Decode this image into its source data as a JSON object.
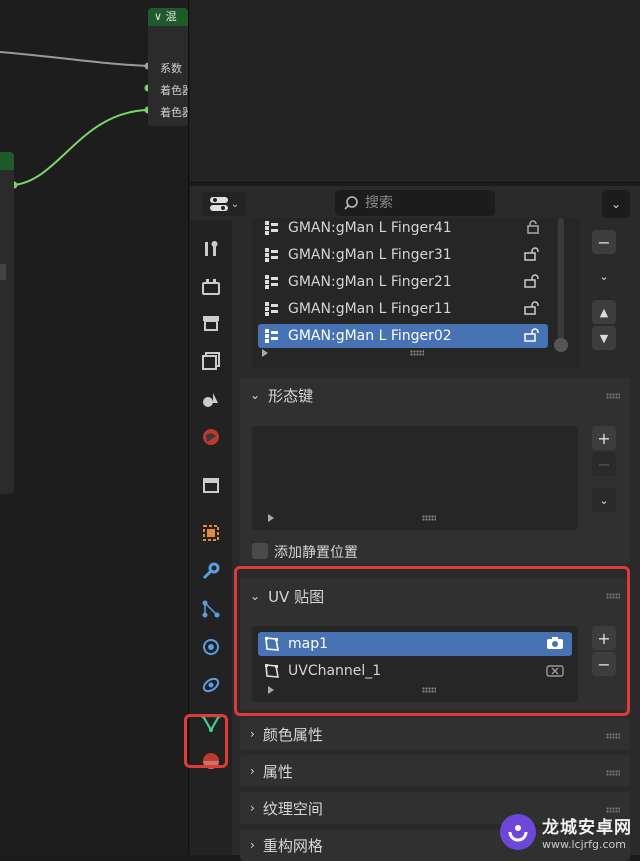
{
  "node_editor": {
    "mix_node": {
      "title": "混",
      "sockets": [
        "系数",
        "着色器",
        "着色器"
      ]
    }
  },
  "properties": {
    "search": {
      "placeholder": "搜索"
    },
    "tabs": [
      "tool-icon",
      "render-icon",
      "output-icon",
      "view-layer-icon",
      "scene-icon",
      "world-icon",
      "collection-icon",
      "object-icon",
      "modifier-icon",
      "particles-icon",
      "physics-icon",
      "constraints-icon",
      "data-icon",
      "material-icon"
    ],
    "bone_list": {
      "items": [
        {
          "label": "GMAN:gMan L Finger41",
          "selected": false
        },
        {
          "label": "GMAN:gMan L Finger31",
          "selected": false
        },
        {
          "label": "GMAN:gMan L Finger21",
          "selected": false
        },
        {
          "label": "GMAN:gMan L Finger11",
          "selected": false
        },
        {
          "label": "GMAN:gMan L Finger02",
          "selected": true
        }
      ]
    },
    "shape_keys": {
      "title": "形态键",
      "relative_label": "添加静置位置"
    },
    "uv_maps": {
      "title": "UV 贴图",
      "items": [
        {
          "label": "map1",
          "selected": true
        },
        {
          "label": "UVChannel_1",
          "selected": false
        }
      ]
    },
    "color_attributes": {
      "title": "颜色属性"
    },
    "attributes": {
      "title": "属性"
    },
    "texture_space": {
      "title": "纹理空间"
    },
    "remesh": {
      "title": "重构网格"
    }
  },
  "colors": {
    "selected": "#4772b3",
    "highlight": "#e03b3b",
    "node_header": "#1f5a2a"
  },
  "watermark": {
    "title": "龙城安卓网",
    "url": "www.lcjrfg.com"
  }
}
